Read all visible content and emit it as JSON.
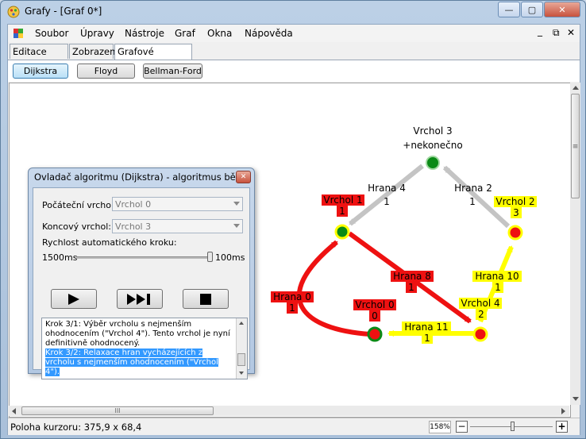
{
  "window": {
    "title": "Grafy - [Graf 0*]",
    "minimize": "—",
    "maximize": "▢",
    "close": "✕"
  },
  "menu": {
    "items": [
      "Soubor",
      "Úpravy",
      "Nástroje",
      "Graf",
      "Okna",
      "Nápověda"
    ],
    "mdi_minimize": "_",
    "mdi_restore": "⧉",
    "mdi_close": "✕"
  },
  "tabs": [
    "Editace grafu",
    "Zobrazení",
    "Grafové algoritmy"
  ],
  "algorithms": [
    "Dijkstra",
    "Floyd",
    "Bellman-Ford"
  ],
  "graph": {
    "nodes": {
      "v3": {
        "label": "Vrchol 3",
        "dist": "+nekonečno"
      },
      "v1": {
        "label": "Vrchol 1",
        "dist": "1"
      },
      "v2": {
        "label": "Vrchol 2",
        "dist": "3"
      },
      "v0": {
        "label": "Vrchol 0",
        "dist": "0"
      },
      "v4": {
        "label": "Vrchol 4",
        "dist": "2"
      }
    },
    "edges": {
      "e4": {
        "label": "Hrana 4",
        "weight": "1"
      },
      "e2": {
        "label": "Hrana 2",
        "weight": "1"
      },
      "e8": {
        "label": "Hrana 8",
        "weight": "1"
      },
      "e0": {
        "label": "Hrana 0",
        "weight": "1"
      },
      "e10": {
        "label": "Hrana 10",
        "weight": "1"
      },
      "e11": {
        "label": "Hrana 11",
        "weight": "1"
      }
    },
    "colors": {
      "red": "#ee1111",
      "yellow": "#ffff00",
      "gray": "#c4c4c4",
      "green": "#0a8a16",
      "orange": "#ff6600"
    }
  },
  "scroll": {
    "hthumb": "III",
    "vthumb": "≡"
  },
  "status": {
    "cursor": "Poloha kurzoru: 375,9 x 68,4",
    "zoom": "158%",
    "zoom_minus": "−",
    "zoom_plus": "+"
  },
  "dialog": {
    "title": "Ovladač algoritmu (Dijkstra) - algoritmus běží",
    "close": "✕",
    "start_label": "Počáteční vrchol:",
    "start_value": "Vrchol 0",
    "end_label": "Koncový vrchol:",
    "end_value": "Vrchol 3",
    "speed_label": "Rychlost automatického kroku:",
    "speed_min": "1500ms",
    "speed_max": "100ms",
    "log_step1": "Krok 3/1: Výběr vrcholu s nejmenším ohodnocením (\"Vrchol 4\"). Tento vrchol je nyní definitivně ohodnocený.",
    "log_step2": "Krok 3/2: Relaxace hran vycházejících z vrcholu s nejmenším ohodnocením (\"Vrchol 4\")."
  }
}
